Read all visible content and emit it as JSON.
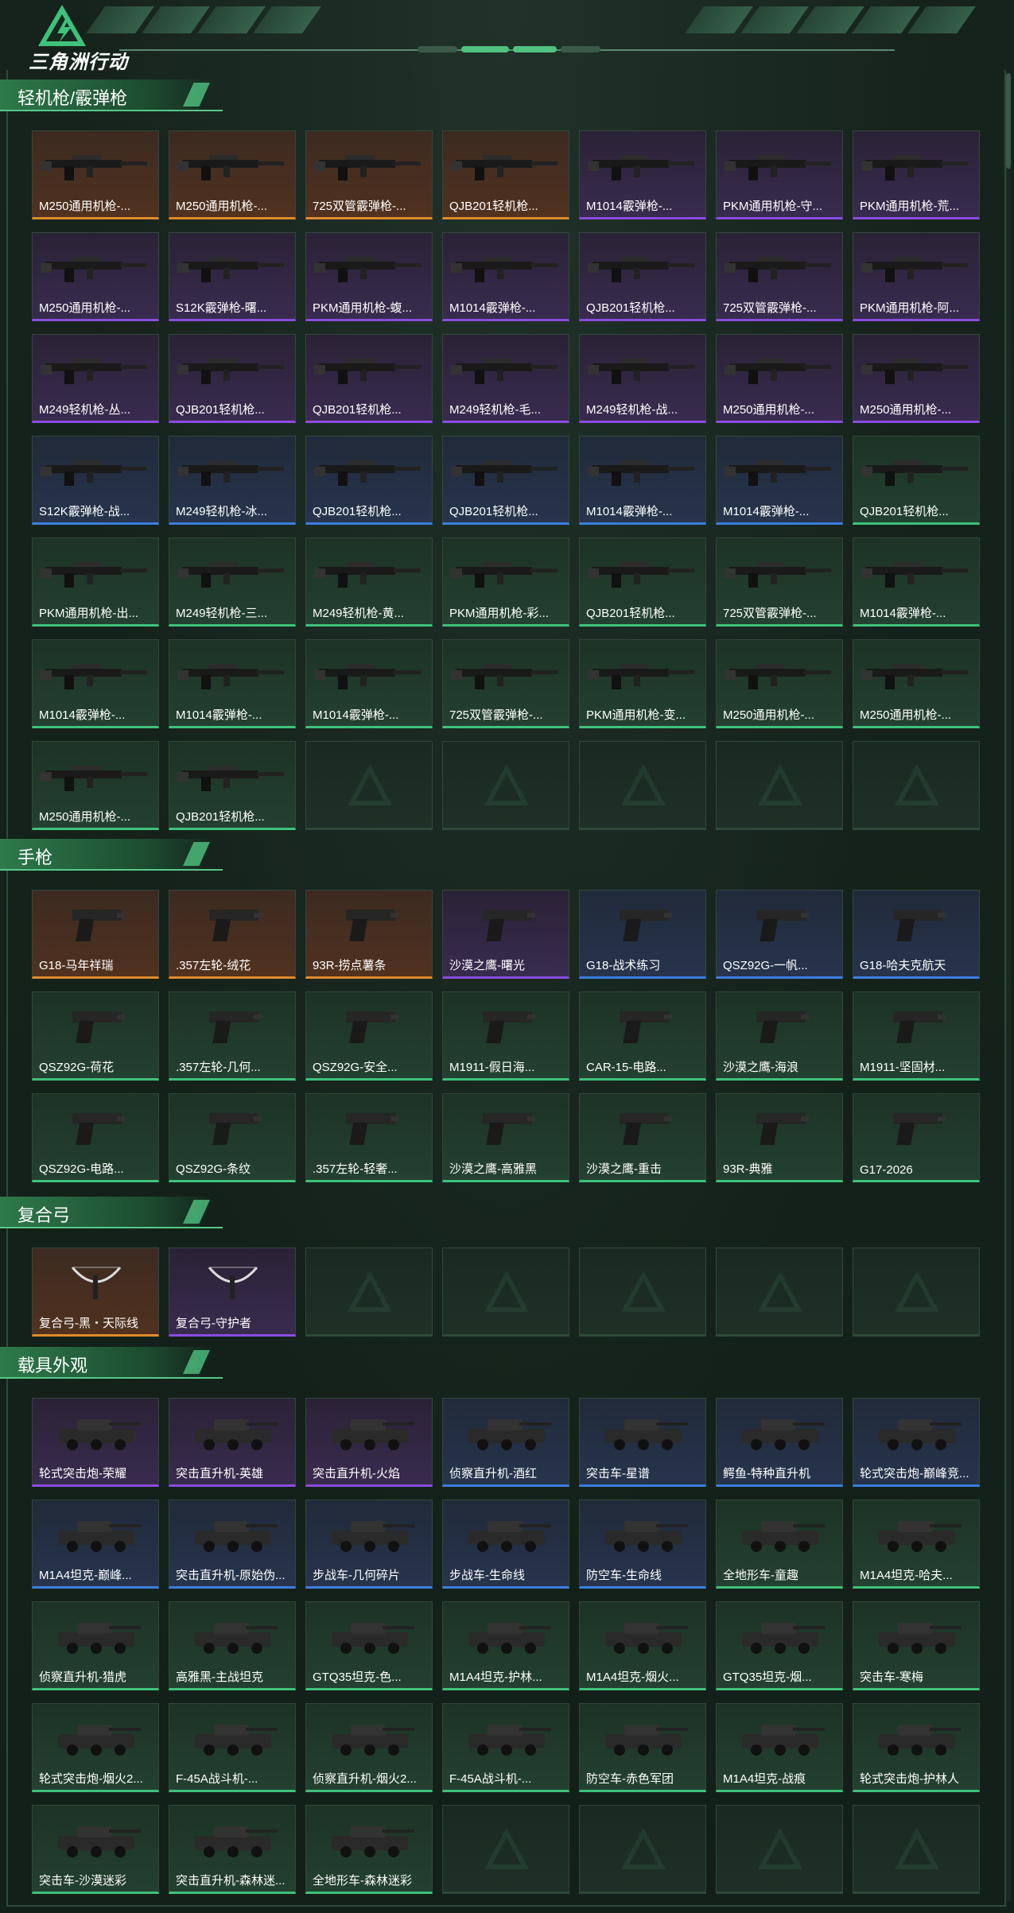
{
  "header": {
    "logo_text": "三角洲行动"
  },
  "colors": {
    "rarity_orange": "#e08a2c",
    "rarity_purple": "#8a4ce0",
    "rarity_blue": "#3b7ee0",
    "rarity_green": "#3ec27a",
    "accent": "#4fc27f"
  },
  "sections": [
    {
      "title": "轻机枪/霰弹枪",
      "icon": "gun-icon",
      "items": [
        {
          "name": "M250通用机枪-...",
          "rarity": "orange"
        },
        {
          "name": "M250通用机枪-...",
          "rarity": "orange"
        },
        {
          "name": "725双管霰弹枪-...",
          "rarity": "orange"
        },
        {
          "name": "QJB201轻机枪...",
          "rarity": "orange"
        },
        {
          "name": "M1014霰弹枪-...",
          "rarity": "purple"
        },
        {
          "name": "PKM通用机枪-守...",
          "rarity": "purple"
        },
        {
          "name": "PKM通用机枪-荒...",
          "rarity": "purple"
        },
        {
          "name": "M250通用机枪-...",
          "rarity": "purple"
        },
        {
          "name": "S12K霰弹枪-曙...",
          "rarity": "purple"
        },
        {
          "name": "PKM通用机枪-蝮...",
          "rarity": "purple"
        },
        {
          "name": "M1014霰弹枪-...",
          "rarity": "purple"
        },
        {
          "name": "QJB201轻机枪...",
          "rarity": "purple"
        },
        {
          "name": "725双管霰弹枪-...",
          "rarity": "purple"
        },
        {
          "name": "PKM通用机枪-阿...",
          "rarity": "purple"
        },
        {
          "name": "M249轻机枪-丛...",
          "rarity": "purple"
        },
        {
          "name": "QJB201轻机枪...",
          "rarity": "purple"
        },
        {
          "name": "QJB201轻机枪...",
          "rarity": "purple"
        },
        {
          "name": "M249轻机枪-毛...",
          "rarity": "purple"
        },
        {
          "name": "M249轻机枪-战...",
          "rarity": "purple"
        },
        {
          "name": "M250通用机枪-...",
          "rarity": "purple"
        },
        {
          "name": "M250通用机枪-...",
          "rarity": "purple"
        },
        {
          "name": "S12K霰弹枪-战...",
          "rarity": "blue"
        },
        {
          "name": "M249轻机枪-冰...",
          "rarity": "blue"
        },
        {
          "name": "QJB201轻机枪...",
          "rarity": "blue"
        },
        {
          "name": "QJB201轻机枪...",
          "rarity": "blue"
        },
        {
          "name": "M1014霰弹枪-...",
          "rarity": "blue"
        },
        {
          "name": "M1014霰弹枪-...",
          "rarity": "blue"
        },
        {
          "name": "QJB201轻机枪...",
          "rarity": "green"
        },
        {
          "name": "PKM通用机枪-出...",
          "rarity": "green"
        },
        {
          "name": "M249轻机枪-三...",
          "rarity": "green"
        },
        {
          "name": "M249轻机枪-黄...",
          "rarity": "green"
        },
        {
          "name": "PKM通用机枪-彩...",
          "rarity": "green"
        },
        {
          "name": "QJB201轻机枪...",
          "rarity": "green"
        },
        {
          "name": "725双管霰弹枪-...",
          "rarity": "green"
        },
        {
          "name": "M1014霰弹枪-...",
          "rarity": "green"
        },
        {
          "name": "M1014霰弹枪-...",
          "rarity": "green"
        },
        {
          "name": "M1014霰弹枪-...",
          "rarity": "green"
        },
        {
          "name": "M1014霰弹枪-...",
          "rarity": "green"
        },
        {
          "name": "725双管霰弹枪-...",
          "rarity": "green"
        },
        {
          "name": "PKM通用机枪-变...",
          "rarity": "green"
        },
        {
          "name": "M250通用机枪-...",
          "rarity": "green"
        },
        {
          "name": "M250通用机枪-...",
          "rarity": "green"
        },
        {
          "name": "M250通用机枪-...",
          "rarity": "green"
        },
        {
          "name": "QJB201轻机枪...",
          "rarity": "green"
        }
      ],
      "empty_slots": 5
    },
    {
      "title": "手枪",
      "icon": "pistol-icon",
      "items": [
        {
          "name": "G18-马年祥瑞",
          "rarity": "orange"
        },
        {
          "name": ".357左轮-绒花",
          "rarity": "orange"
        },
        {
          "name": "93R-捞点薯条",
          "rarity": "orange"
        },
        {
          "name": "沙漠之鹰-曙光",
          "rarity": "purple"
        },
        {
          "name": "G18-战术练习",
          "rarity": "blue"
        },
        {
          "name": "QSZ92G-一帆...",
          "rarity": "blue"
        },
        {
          "name": "G18-哈夫克航天",
          "rarity": "blue"
        },
        {
          "name": "QSZ92G-荷花",
          "rarity": "green"
        },
        {
          "name": ".357左轮-几何...",
          "rarity": "green"
        },
        {
          "name": "QSZ92G-安全...",
          "rarity": "green"
        },
        {
          "name": "M1911-假日海...",
          "rarity": "green"
        },
        {
          "name": "CAR-15-电路...",
          "rarity": "green"
        },
        {
          "name": "沙漠之鹰-海浪",
          "rarity": "green"
        },
        {
          "name": "M1911-坚固材...",
          "rarity": "green"
        },
        {
          "name": "QSZ92G-电路...",
          "rarity": "green"
        },
        {
          "name": "QSZ92G-条纹",
          "rarity": "green"
        },
        {
          "name": ".357左轮-轻奢...",
          "rarity": "green"
        },
        {
          "name": "沙漠之鹰-高雅黑",
          "rarity": "green"
        },
        {
          "name": "沙漠之鹰-重击",
          "rarity": "green"
        },
        {
          "name": "93R-典雅",
          "rarity": "green"
        },
        {
          "name": "G17-2026",
          "rarity": "green"
        }
      ],
      "empty_slots": 0
    },
    {
      "title": "复合弓",
      "icon": "bow-icon",
      "items": [
        {
          "name": "复合弓-黑・天际线",
          "rarity": "orange"
        },
        {
          "name": "复合弓-守护者",
          "rarity": "purple"
        }
      ],
      "empty_slots": 5
    },
    {
      "title": "载具外观",
      "icon": "vehicle-icon",
      "items": [
        {
          "name": "轮式突击炮-荣耀",
          "rarity": "purple"
        },
        {
          "name": "突击直升机-英雄",
          "rarity": "purple"
        },
        {
          "name": "突击直升机-火焰",
          "rarity": "purple"
        },
        {
          "name": "侦察直升机-酒红",
          "rarity": "blue"
        },
        {
          "name": "突击车-星谱",
          "rarity": "blue"
        },
        {
          "name": "鳄鱼-特种直升机",
          "rarity": "blue"
        },
        {
          "name": "轮式突击炮-巅峰竞...",
          "rarity": "blue"
        },
        {
          "name": "M1A4坦克-巅峰...",
          "rarity": "blue"
        },
        {
          "name": "突击直升机-原始伪...",
          "rarity": "blue"
        },
        {
          "name": "步战车-几何碎片",
          "rarity": "blue"
        },
        {
          "name": "步战车-生命线",
          "rarity": "blue"
        },
        {
          "name": "防空车-生命线",
          "rarity": "blue"
        },
        {
          "name": "全地形车-童趣",
          "rarity": "green"
        },
        {
          "name": "M1A4坦克-哈夫...",
          "rarity": "green"
        },
        {
          "name": "侦察直升机-猎虎",
          "rarity": "green"
        },
        {
          "name": "高雅黑-主战坦克",
          "rarity": "green"
        },
        {
          "name": "GTQ35坦克-色...",
          "rarity": "green"
        },
        {
          "name": "M1A4坦克-护林...",
          "rarity": "green"
        },
        {
          "name": "M1A4坦克-烟火...",
          "rarity": "green"
        },
        {
          "name": "GTQ35坦克-烟...",
          "rarity": "green"
        },
        {
          "name": "突击车-寒梅",
          "rarity": "green"
        },
        {
          "name": "轮式突击炮-烟火2...",
          "rarity": "green"
        },
        {
          "name": "F-45A战斗机-...",
          "rarity": "green"
        },
        {
          "name": "侦察直升机-烟火2...",
          "rarity": "green"
        },
        {
          "name": "F-45A战斗机-...",
          "rarity": "green"
        },
        {
          "name": "防空车-赤色军团",
          "rarity": "green"
        },
        {
          "name": "M1A4坦克-战痕",
          "rarity": "green"
        },
        {
          "name": "轮式突击炮-护林人",
          "rarity": "green"
        },
        {
          "name": "突击车-沙漠迷彩",
          "rarity": "green"
        },
        {
          "name": "突击直升机-森林迷...",
          "rarity": "green"
        },
        {
          "name": "全地形车-森林迷彩",
          "rarity": "green"
        }
      ],
      "empty_slots": 4
    }
  ]
}
